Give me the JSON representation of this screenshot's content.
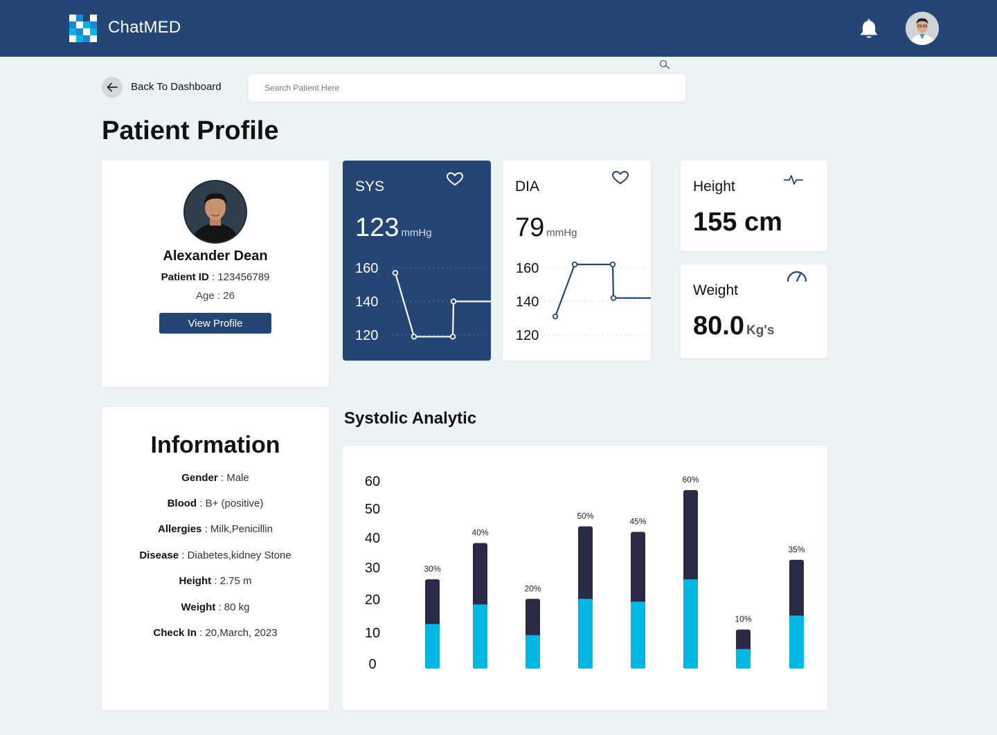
{
  "header": {
    "brand": "ChatMED",
    "colors": {
      "primary": "#254674",
      "accent": "#00B7E3",
      "dark_bar": "#2A2A46"
    },
    "icons": [
      "logo-icon",
      "bell-icon",
      "user-avatar"
    ]
  },
  "nav": {
    "back_label": "Back To Dashboard",
    "search_placeholder": "Search Patient Here"
  },
  "page_title": "Patient Profile",
  "profile": {
    "name": "Alexander Dean",
    "id_key": "Patient ID",
    "id_value": "123456789",
    "age_key": "Age",
    "age_value": "26",
    "view_button": "View Profile"
  },
  "vitals": {
    "sys": {
      "label": "SYS",
      "value": "123",
      "unit": "mmHg",
      "ticks": [
        "160",
        "140",
        "120"
      ],
      "points": [
        157,
        119,
        119,
        140,
        140
      ]
    },
    "dia": {
      "label": "DIA",
      "value": "79",
      "unit": "mmHg",
      "ticks": [
        "160",
        "140",
        "120"
      ],
      "points": [
        131,
        162,
        162,
        142,
        142
      ]
    },
    "height": {
      "label": "Height",
      "value": "155 cm"
    },
    "weight": {
      "label": "Weight",
      "value": "80.0",
      "unit": "Kg's"
    }
  },
  "information": {
    "title": "Information",
    "rows": [
      {
        "key": "Gender",
        "value": "Male"
      },
      {
        "key": "Blood",
        "value": "B+ (positive)"
      },
      {
        "key": "Allergies",
        "value": "Milk,Penicillin"
      },
      {
        "key": "Disease",
        "value": "Diabetes,kidney Stone"
      },
      {
        "key": "Height",
        "value": "2.75 m"
      },
      {
        "key": "Weight",
        "value": "80 kg"
      },
      {
        "key": "Check In",
        "value": "20,March, 2023"
      }
    ]
  },
  "analytic": {
    "title": "Systolic Analytic"
  },
  "chart_data": {
    "type": "bar",
    "title": "Systolic Analytic",
    "y_ticks": [
      "60",
      "50",
      "40",
      "30",
      "20",
      "10",
      "0"
    ],
    "ylim": [
      0,
      60
    ],
    "grid": false,
    "stacked": true,
    "labels": [
      "30%",
      "40%",
      "20%",
      "50%",
      "45%",
      "60%",
      "10%",
      "35%"
    ],
    "series": [
      {
        "values": [
          16,
          23,
          12,
          25,
          24,
          32,
          7,
          19
        ],
        "color": "#00B7E3"
      },
      {
        "values": [
          16,
          22,
          13,
          26,
          25,
          32,
          7,
          20
        ],
        "color": "#2A2A46"
      }
    ]
  }
}
